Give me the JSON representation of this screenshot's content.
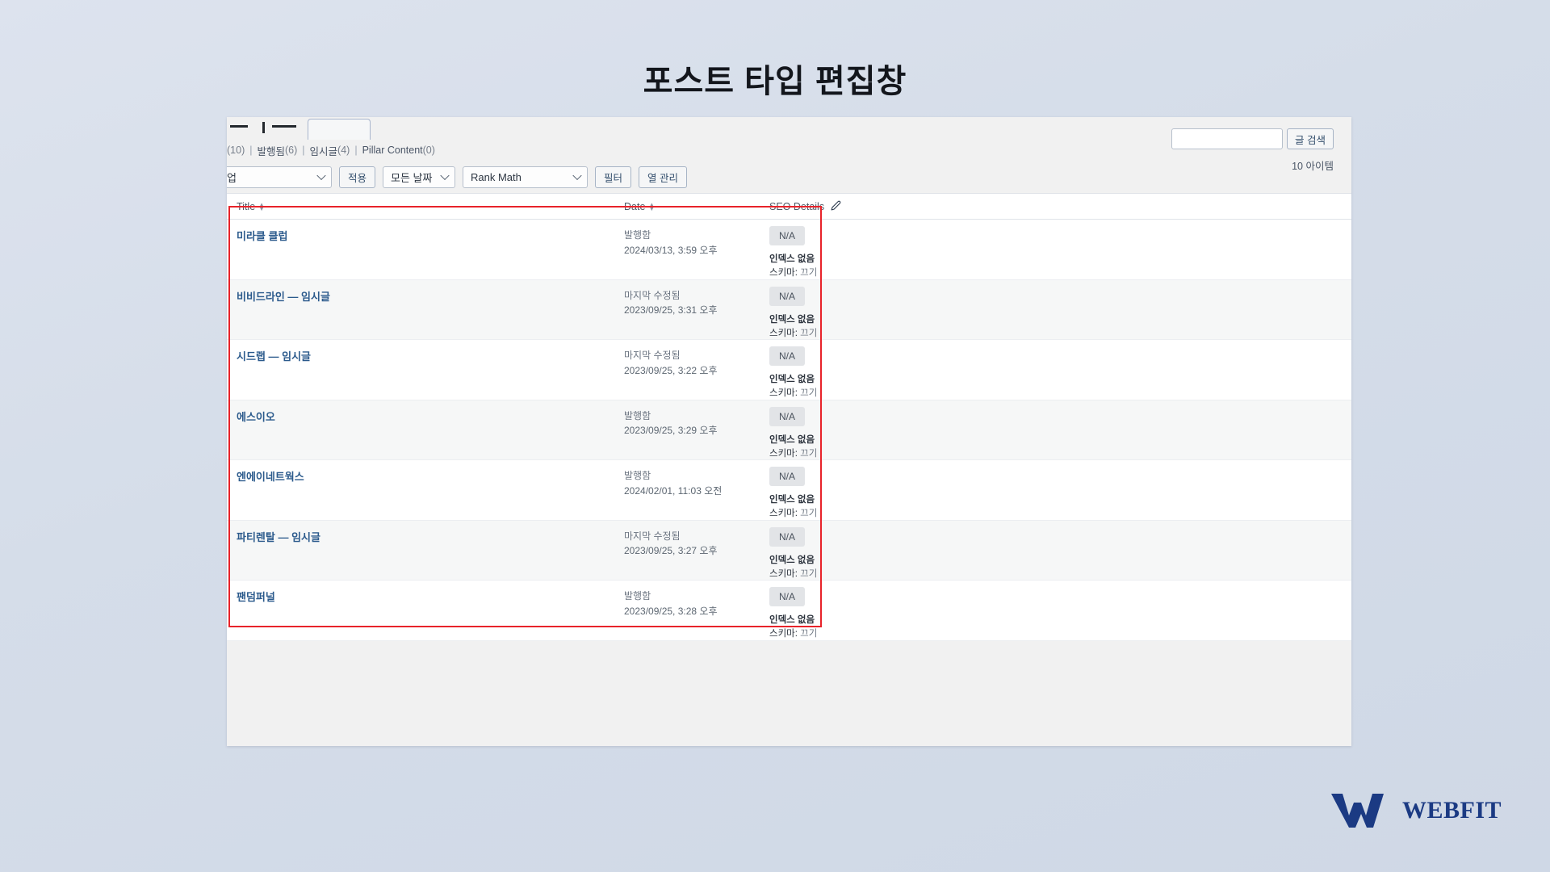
{
  "page": {
    "heading": "포스트 타입 편집창"
  },
  "filters": {
    "links": [
      {
        "label": "",
        "count": "(10)"
      },
      {
        "label": "발행됨",
        "count": "(6)"
      },
      {
        "label": "임시글",
        "count": "(4)"
      },
      {
        "label": "Pillar Content",
        "count": "(0)"
      }
    ],
    "separator": "|"
  },
  "tablenav": {
    "bulk_select": "작업",
    "apply_button": "적용",
    "date_select": "모든 날짜",
    "seo_select": "Rank Math",
    "filter_button": "필터",
    "columns_button": "열 관리"
  },
  "search": {
    "value": "",
    "placeholder": "",
    "button": "글 검색"
  },
  "summary": {
    "item_count": "10 아이템"
  },
  "table": {
    "headers": {
      "title": "Title",
      "date": "Date",
      "seo": "SEO Details"
    },
    "rows": [
      {
        "title": "미라클 클럽",
        "date_status": "발행함",
        "date_value": "2024/03/13, 3:59 오후",
        "seo_badge": "N/A",
        "seo_index": "인덱스 없음",
        "seo_schema_label": "스키마:",
        "seo_schema_value": "끄기"
      },
      {
        "title": "비비드라인 — 임시글",
        "date_status": "마지막 수정됨",
        "date_value": "2023/09/25, 3:31 오후",
        "seo_badge": "N/A",
        "seo_index": "인덱스 없음",
        "seo_schema_label": "스키마:",
        "seo_schema_value": "끄기"
      },
      {
        "title": "시드랩 — 임시글",
        "date_status": "마지막 수정됨",
        "date_value": "2023/09/25, 3:22 오후",
        "seo_badge": "N/A",
        "seo_index": "인덱스 없음",
        "seo_schema_label": "스키마:",
        "seo_schema_value": "끄기"
      },
      {
        "title": "에스이오",
        "date_status": "발행함",
        "date_value": "2023/09/25, 3:29 오후",
        "seo_badge": "N/A",
        "seo_index": "인덱스 없음",
        "seo_schema_label": "스키마:",
        "seo_schema_value": "끄기"
      },
      {
        "title": "엔에이네트웍스",
        "date_status": "발행함",
        "date_value": "2024/02/01, 11:03 오전",
        "seo_badge": "N/A",
        "seo_index": "인덱스 없음",
        "seo_schema_label": "스키마:",
        "seo_schema_value": "끄기"
      },
      {
        "title": "파티렌탈 — 임시글",
        "date_status": "마지막 수정됨",
        "date_value": "2023/09/25, 3:27 오후",
        "seo_badge": "N/A",
        "seo_index": "인덱스 없음",
        "seo_schema_label": "스키마:",
        "seo_schema_value": "끄기"
      },
      {
        "title": "팬덤퍼널",
        "date_status": "발행함",
        "date_value": "2023/09/25, 3:28 오후",
        "seo_badge": "N/A",
        "seo_index": "인덱스 없음",
        "seo_schema_label": "스키마:",
        "seo_schema_value": "끄기"
      }
    ]
  },
  "branding": {
    "logo_text": "WEBFIT",
    "logo_color": "#1b3a83"
  },
  "annotation": {
    "highlight_color": "#e8232a"
  }
}
